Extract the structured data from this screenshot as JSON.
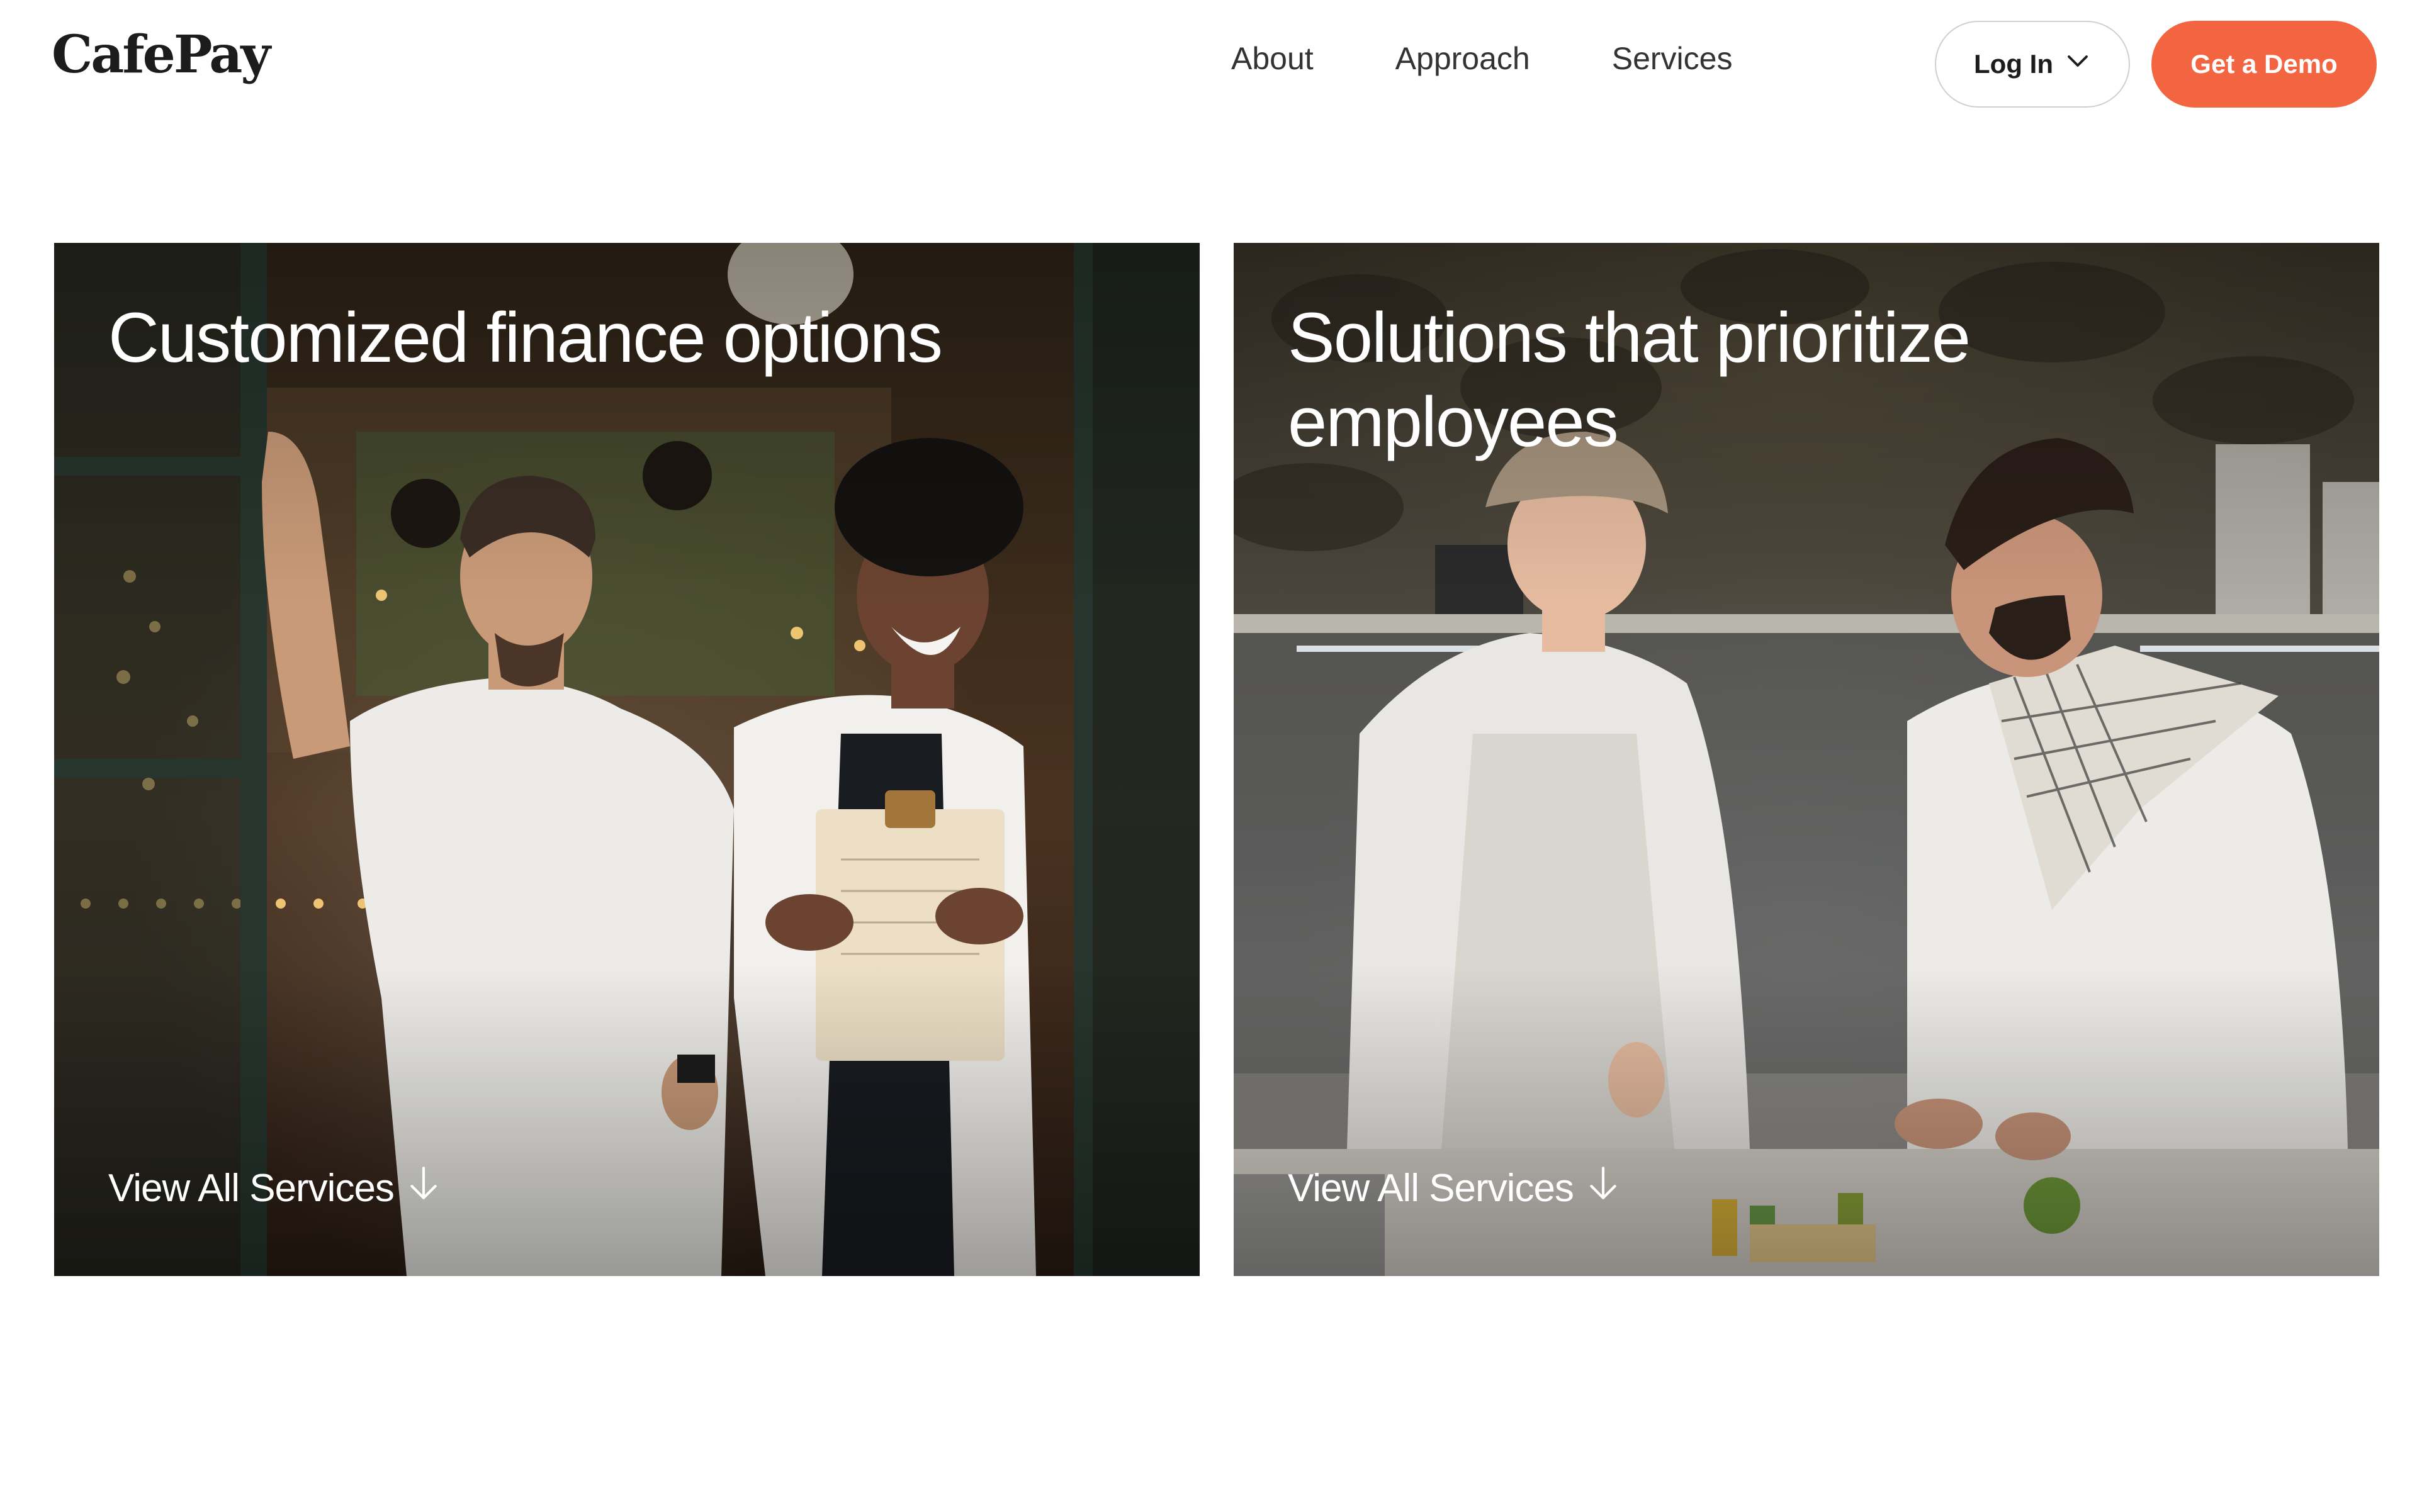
{
  "header": {
    "logo": "CafePay",
    "nav": [
      {
        "label": "About"
      },
      {
        "label": "Approach"
      },
      {
        "label": "Services"
      }
    ],
    "login_label": "Log In",
    "login_icon": "chevron-down-icon",
    "demo_label": "Get a Demo"
  },
  "cards": [
    {
      "title": "Customized finance options",
      "link_label": "View All Services",
      "link_icon": "arrow-down-icon",
      "image": "cafe-staff-photo"
    },
    {
      "title": "Solutions that prioritize employees",
      "link_label": "View All Services",
      "link_icon": "arrow-down-icon",
      "image": "kitchen-chefs-photo"
    }
  ],
  "colors": {
    "accent": "#f26540",
    "text": "#1c1c1c",
    "nav_text": "#333333",
    "button_border": "#cfcfcf"
  }
}
